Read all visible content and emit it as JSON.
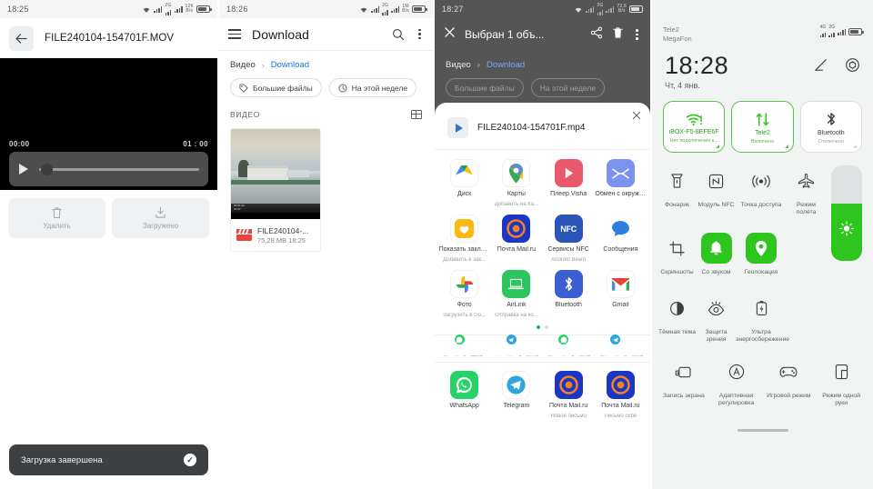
{
  "panel1": {
    "status": {
      "time": "18:25"
    },
    "appbar": {
      "back_icon": "arrow-left-icon",
      "title": "FILE240104-154701F.MOV"
    },
    "player": {
      "current_time": "00:00",
      "total_time": "01 : 00",
      "play_icon": "play-icon",
      "progress_percent": 2
    },
    "actions": [
      {
        "label": "Удалить",
        "icon": "trash-icon"
      },
      {
        "label": "Загружено",
        "icon": "download-icon"
      }
    ],
    "toast": {
      "text": "Загрузка завершена",
      "icon": "check-circle-icon"
    }
  },
  "panel2": {
    "status": {
      "time": "18:26"
    },
    "appbar": {
      "menu_icon": "hamburger-icon",
      "title": "Download",
      "search_icon": "search-icon",
      "overflow_icon": "kebab-menu-icon"
    },
    "breadcrumb": {
      "root": "Видео",
      "separator": "›",
      "current": "Download"
    },
    "chips": [
      {
        "label": "Большие файлы",
        "icon": "tag-icon"
      },
      {
        "label": "На этой неделе",
        "icon": "clock-icon"
      }
    ],
    "section": {
      "title": "ВИДЕО",
      "view_icon": "list-view-icon"
    },
    "file": {
      "name": "FILE240104-...",
      "size_time": "75,28 MB 18:25",
      "type_icon": "clapperboard-icon"
    }
  },
  "panel3": {
    "status": {
      "time": "18:27"
    },
    "appbar": {
      "close_icon": "close-icon",
      "title": "Выбран 1 объ...",
      "share_icon": "share-icon",
      "delete_icon": "trash-icon",
      "overflow_icon": "kebab-menu-icon"
    },
    "breadcrumb": {
      "root": "Видео",
      "separator": "›",
      "current": "Download"
    },
    "chips": [
      {
        "label": "Большие файлы"
      },
      {
        "label": "На этой неделе"
      }
    ],
    "sheet": {
      "close_icon": "close-icon",
      "file_icon": "play-icon",
      "file_name": "FILE240104-154701F.mp4",
      "apps": [
        {
          "label": "Диск",
          "sub": "",
          "icon": "google-drive-icon"
        },
        {
          "label": "Карты",
          "sub": "Добавить на Ка...",
          "icon": "google-maps-icon"
        },
        {
          "label": "Плеер Visha",
          "sub": "",
          "icon": "visha-player-icon"
        },
        {
          "label": "Обмен с окруже...",
          "sub": "",
          "icon": "nearby-share-icon"
        },
        {
          "label": "Показать заклад...",
          "sub": "Добавить в зак...",
          "icon": "bookmark-icon"
        },
        {
          "label": "Почта Mail.ru",
          "sub": "",
          "icon": "mailru-icon"
        },
        {
          "label": "Сервисы NFC",
          "sub": "Android Beam",
          "icon": "nfc-icon"
        },
        {
          "label": "Сообщения",
          "sub": "",
          "icon": "messages-icon"
        },
        {
          "label": "Фото",
          "sub": "Загрузить в Go...",
          "icon": "google-photos-icon"
        },
        {
          "label": "AirLink",
          "sub": "Отправка на ко...",
          "icon": "airlink-icon"
        },
        {
          "label": "Bluetooth",
          "sub": "",
          "icon": "bluetooth-icon"
        },
        {
          "label": "Gmail",
          "sub": "",
          "icon": "gmail-icon"
        }
      ],
      "page_dots": {
        "count": 2,
        "active": 0
      },
      "contacts": [
        {
          "app": "whatsapp"
        },
        {
          "app": "telegram"
        },
        {
          "app": "whatsapp"
        },
        {
          "app": "telegram"
        }
      ],
      "share_targets": [
        {
          "label": "WhatsApp",
          "sub": "",
          "icon": "whatsapp-icon"
        },
        {
          "label": "Telegram",
          "sub": "",
          "icon": "telegram-icon"
        },
        {
          "label": "Почта Mail.ru",
          "sub": "Новое письмо",
          "icon": "mailru-icon"
        },
        {
          "label": "Почта Mail.ru",
          "sub": "Письмо себе",
          "icon": "mailru-icon"
        }
      ]
    }
  },
  "panel4": {
    "carriers": [
      "Tele2",
      "MegaFon"
    ],
    "clock": "18:28",
    "date": "Чт, 4 янв.",
    "header_icons": [
      {
        "icon": "edit-icon"
      },
      {
        "icon": "settings-icon"
      }
    ],
    "big_tiles": [
      {
        "label": "iBOX-F5-8EFE6F",
        "sub": "Нет подключения к...",
        "icon": "wifi-alert-icon",
        "on": true
      },
      {
        "label": "Tele2",
        "sub": "Включено",
        "icon": "mobile-data-icon",
        "on": true
      },
      {
        "label": "Bluetooth",
        "sub": "Отключено",
        "icon": "bluetooth-icon",
        "on": false
      }
    ],
    "tiles": [
      {
        "label": "Фонарик",
        "icon": "flashlight-icon",
        "on": false
      },
      {
        "label": "Модуль NFC",
        "icon": "nfc-icon",
        "on": false
      },
      {
        "label": "Точка доступа",
        "icon": "hotspot-icon",
        "on": false
      },
      {
        "label": "Режим полета",
        "icon": "airplane-icon",
        "on": false
      },
      {
        "label": "Скриншоты",
        "icon": "screenshot-icon",
        "on": false
      },
      {
        "label": "Со звуком",
        "icon": "bell-icon",
        "on": true
      },
      {
        "label": "Геолокация",
        "icon": "location-pin-icon",
        "on": true
      },
      {
        "label": "Тёмная тема",
        "icon": "dark-theme-icon",
        "on": false
      },
      {
        "label": "Защита зрения",
        "icon": "eye-care-icon",
        "on": false
      },
      {
        "label": "Ультра энергосбережение",
        "icon": "battery-saver-icon",
        "on": false
      }
    ],
    "tiles_row3": [
      {
        "label": "Запись экрана",
        "icon": "screen-record-icon"
      },
      {
        "label": "Адаптивная регулировка",
        "icon": "adaptive-brightness-icon"
      },
      {
        "label": "Игровой режим",
        "icon": "gamepad-icon"
      },
      {
        "label": "Режим одной руки",
        "icon": "one-hand-mode-icon"
      }
    ],
    "brightness": {
      "icon": "brightness-icon",
      "percent": 60
    }
  }
}
